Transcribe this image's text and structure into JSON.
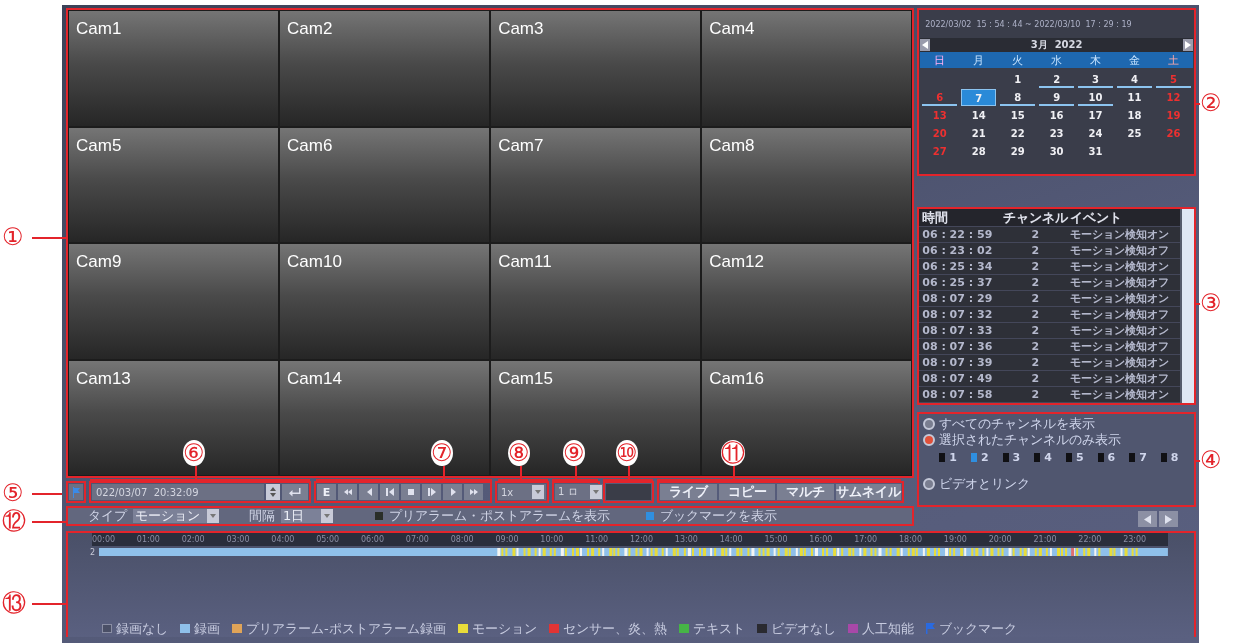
{
  "callouts": [
    {
      "label": "①"
    },
    {
      "label": "②"
    },
    {
      "label": "③"
    },
    {
      "label": "④"
    },
    {
      "label": "⑤"
    },
    {
      "label": "⑥"
    },
    {
      "label": "⑦"
    },
    {
      "label": "⑧"
    },
    {
      "label": "⑨"
    },
    {
      "label": "⑩"
    },
    {
      "label": "⑪"
    },
    {
      "label": "⑫"
    },
    {
      "label": "⑬"
    }
  ],
  "cameras": [
    "Cam1",
    "Cam2",
    "Cam3",
    "Cam4",
    "Cam5",
    "Cam6",
    "Cam7",
    "Cam8",
    "Cam9",
    "Cam10",
    "Cam11",
    "Cam12",
    "Cam13",
    "Cam14",
    "Cam15",
    "Cam16"
  ],
  "calendar": {
    "range": "2022/03/02  15 : 54 : 44 ~ 2022/03/10  17 : 29 : 19",
    "month": "3月  2022",
    "weekdays": [
      {
        "label": "日",
        "kind": "sunday"
      },
      {
        "label": "月",
        "kind": "weekday"
      },
      {
        "label": "火",
        "kind": "weekday"
      },
      {
        "label": "水",
        "kind": "weekday"
      },
      {
        "label": "木",
        "kind": "weekday"
      },
      {
        "label": "金",
        "kind": "weekday"
      },
      {
        "label": "土",
        "kind": "saturday"
      }
    ],
    "days": [
      {
        "label": "1",
        "weekend": false,
        "recorded": false,
        "selected": false
      },
      {
        "label": "2",
        "weekend": false,
        "recorded": true,
        "selected": false
      },
      {
        "label": "3",
        "weekend": false,
        "recorded": true,
        "selected": false
      },
      {
        "label": "4",
        "weekend": false,
        "recorded": true,
        "selected": false
      },
      {
        "label": "5",
        "weekend": true,
        "recorded": true,
        "selected": false
      },
      {
        "label": "6",
        "weekend": true,
        "recorded": true,
        "selected": false
      },
      {
        "label": "7",
        "weekend": false,
        "recorded": true,
        "selected": true
      },
      {
        "label": "8",
        "weekend": false,
        "recorded": true,
        "selected": false
      },
      {
        "label": "9",
        "weekend": false,
        "recorded": true,
        "selected": false
      },
      {
        "label": "10",
        "weekend": false,
        "recorded": true,
        "selected": false
      },
      {
        "label": "11",
        "weekend": false,
        "recorded": false,
        "selected": false
      },
      {
        "label": "12",
        "weekend": true,
        "recorded": false,
        "selected": false
      },
      {
        "label": "13",
        "weekend": true,
        "recorded": false,
        "selected": false
      },
      {
        "label": "14",
        "weekend": false,
        "recorded": false,
        "selected": false
      },
      {
        "label": "15",
        "weekend": false,
        "recorded": false,
        "selected": false
      },
      {
        "label": "16",
        "weekend": false,
        "recorded": false,
        "selected": false
      },
      {
        "label": "17",
        "weekend": false,
        "recorded": false,
        "selected": false
      },
      {
        "label": "18",
        "weekend": false,
        "recorded": false,
        "selected": false
      },
      {
        "label": "19",
        "weekend": true,
        "recorded": false,
        "selected": false
      },
      {
        "label": "20",
        "weekend": true,
        "recorded": false,
        "selected": false
      },
      {
        "label": "21",
        "weekend": false,
        "recorded": false,
        "selected": false
      },
      {
        "label": "22",
        "weekend": false,
        "recorded": false,
        "selected": false
      },
      {
        "label": "23",
        "weekend": false,
        "recorded": false,
        "selected": false
      },
      {
        "label": "24",
        "weekend": false,
        "recorded": false,
        "selected": false
      },
      {
        "label": "25",
        "weekend": false,
        "recorded": false,
        "selected": false
      },
      {
        "label": "26",
        "weekend": true,
        "recorded": false,
        "selected": false
      },
      {
        "label": "27",
        "weekend": true,
        "recorded": false,
        "selected": false
      },
      {
        "label": "28",
        "weekend": false,
        "recorded": false,
        "selected": false
      },
      {
        "label": "29",
        "weekend": false,
        "recorded": false,
        "selected": false
      },
      {
        "label": "30",
        "weekend": false,
        "recorded": false,
        "selected": false
      },
      {
        "label": "31",
        "weekend": false,
        "recorded": false,
        "selected": false
      }
    ]
  },
  "events": {
    "columns": [
      "時間",
      "チャンネル",
      "イベント"
    ],
    "rows": [
      [
        "06 : 22 : 59",
        "2",
        "モーション検知オン"
      ],
      [
        "06 : 23 : 02",
        "2",
        "モーション検知オフ"
      ],
      [
        "06 : 25 : 34",
        "2",
        "モーション検知オン"
      ],
      [
        "06 : 25 : 37",
        "2",
        "モーション検知オフ"
      ],
      [
        "08 : 07 : 29",
        "2",
        "モーション検知オン"
      ],
      [
        "08 : 07 : 32",
        "2",
        "モーション検知オフ"
      ],
      [
        "08 : 07 : 33",
        "2",
        "モーション検知オン"
      ],
      [
        "08 : 07 : 36",
        "2",
        "モーション検知オフ"
      ],
      [
        "08 : 07 : 39",
        "2",
        "モーション検知オン"
      ],
      [
        "08 : 07 : 49",
        "2",
        "モーション検知オフ"
      ],
      [
        "08 : 07 : 58",
        "2",
        "モーション検知オン"
      ]
    ]
  },
  "channel_filter": {
    "options": [
      {
        "label": "すべてのチャンネルを表示",
        "selected": false
      },
      {
        "label": "選択されたチャンネルのみ表示",
        "selected": true
      }
    ],
    "channels": [
      {
        "label": "1",
        "checked": false
      },
      {
        "label": "2",
        "checked": true
      },
      {
        "label": "3",
        "checked": false
      },
      {
        "label": "4",
        "checked": false
      },
      {
        "label": "5",
        "checked": false
      },
      {
        "label": "6",
        "checked": false
      },
      {
        "label": "7",
        "checked": false
      },
      {
        "label": "8",
        "checked": false
      }
    ],
    "link_option": {
      "label": "ビデオとリンク",
      "selected": false
    }
  },
  "controls": {
    "datetime": "022/03/07  20:32:09",
    "playback": [
      {
        "kind": "text",
        "label": "E"
      },
      {
        "kind": "fast-rewind"
      },
      {
        "kind": "step-back"
      },
      {
        "kind": "reverse-play"
      },
      {
        "kind": "stop"
      },
      {
        "kind": "play"
      },
      {
        "kind": "step-forward"
      },
      {
        "kind": "fast-forward"
      }
    ],
    "speed": "1x",
    "interval": "1 ロ",
    "buttons": [
      "ライブ",
      "コピー",
      "マルチ",
      "サムネイル"
    ]
  },
  "filter": {
    "type_label": "タイプ",
    "type_value": "モーション",
    "interval_label": "間隔",
    "interval_value": "1日",
    "checks": [
      {
        "label": "プリアラーム・ポストアラームを表示",
        "checked": false
      },
      {
        "label": "ブックマークを表示",
        "checked": true
      }
    ]
  },
  "timeline": {
    "hours": [
      "00:00",
      "01:00",
      "02:00",
      "03:00",
      "04:00",
      "05:00",
      "06:00",
      "07:00",
      "08:00",
      "09:00",
      "10:00",
      "11:00",
      "12:00",
      "13:00",
      "14:00",
      "15:00",
      "16:00",
      "17:00",
      "18:00",
      "19:00",
      "20:00",
      "21:00",
      "22:00",
      "23:00"
    ],
    "channel": "2",
    "legend": [
      {
        "label": "録画なし",
        "kind": "empty",
        "color": "#4a4f66"
      },
      {
        "label": "録画",
        "kind": "box",
        "color": "#8fc0ea"
      },
      {
        "label": "プリアラーム-ポストアラーム録画",
        "kind": "box",
        "color": "#e0a458"
      },
      {
        "label": "モーション",
        "kind": "box",
        "color": "#e8dc3a"
      },
      {
        "label": "センサー、炎、熱",
        "kind": "box",
        "color": "#e03434"
      },
      {
        "label": "テキスト",
        "kind": "box",
        "color": "#46b446"
      },
      {
        "label": "ビデオなし",
        "kind": "box",
        "color": "#2a2a30"
      },
      {
        "label": "人工知能",
        "kind": "box",
        "color": "#a848a8"
      },
      {
        "label": "ブックマーク",
        "kind": "flag",
        "color": "#2a6ae0"
      }
    ]
  }
}
